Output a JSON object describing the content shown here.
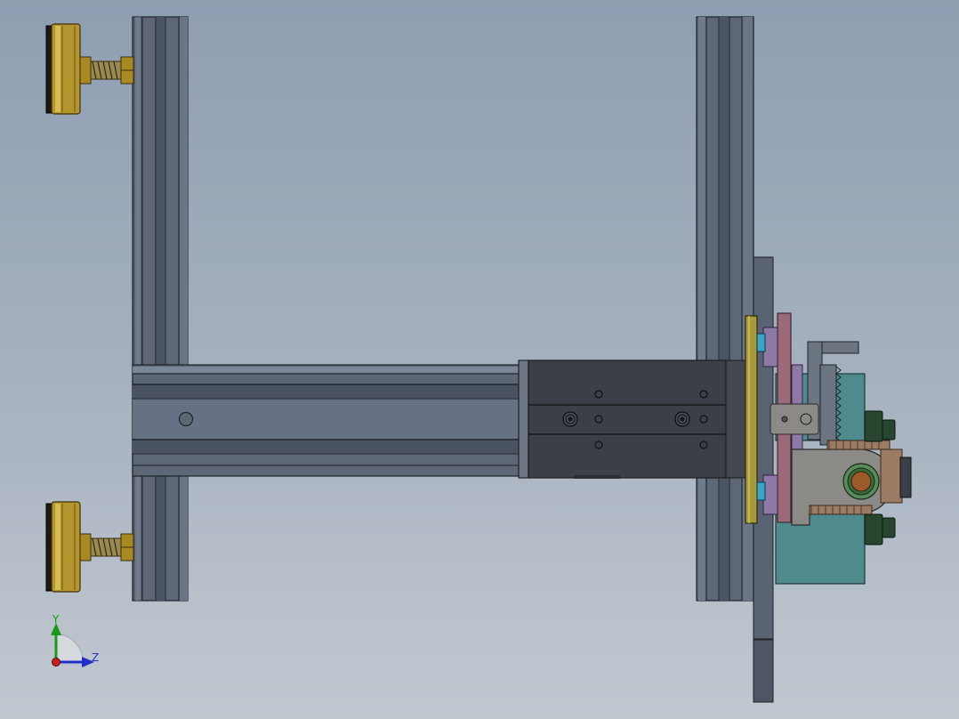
{
  "view": {
    "background_top": "#8e9eb1",
    "background_bottom": "#c2c8d0"
  },
  "triad": {
    "y_label": "Y",
    "z_label": "Z",
    "y_color": "#1a9a1a",
    "z_color": "#1f2fc8",
    "x_color": "#c81e1e"
  },
  "colors": {
    "frame": "#5d6776",
    "frame_dark": "#3f4652",
    "cylinder_body": "#3b3f47",
    "brass": "#b5962e",
    "brass_dark": "#6b5516",
    "plate_yellow": "#a79a3c",
    "pink_block": "#9a6a78",
    "lavender_block": "#8d78a6",
    "teal_housing": "#4f8a8c",
    "dark_green_nut": "#27452f",
    "bracket_grey": "#8b8a86",
    "bushing_bronze": "#9a5a2a",
    "cyan_part": "#3da4c8"
  },
  "components": [
    "left-vertical-rail",
    "right-vertical-rail",
    "horizontal-beam",
    "guided-cylinder",
    "top-leveling-foot",
    "bottom-leveling-foot",
    "mounting-plate",
    "gripper-assembly"
  ]
}
